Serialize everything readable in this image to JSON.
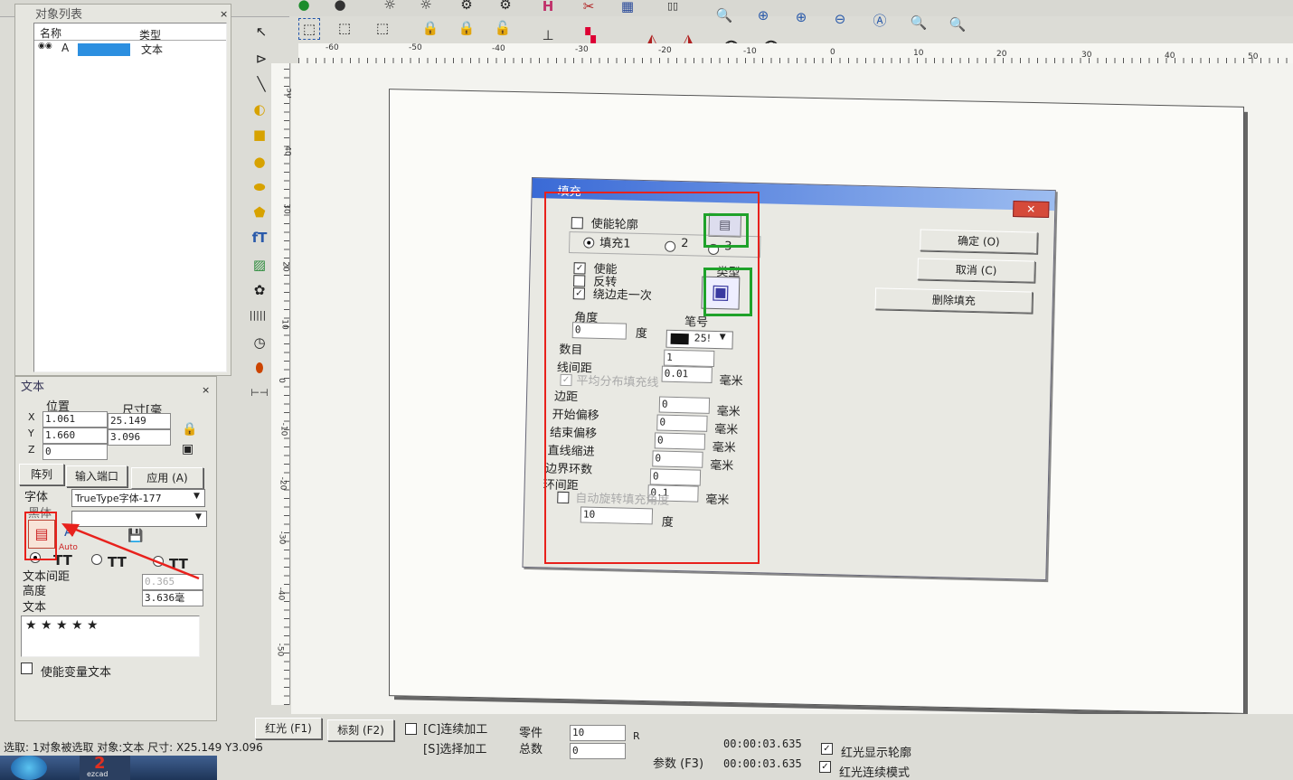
{
  "object_list": {
    "title": "对象列表",
    "col_name": "名称",
    "col_type": "类型",
    "row": {
      "name": "A",
      "type": "文本"
    }
  },
  "text_panel": {
    "title": "文本",
    "pos_label": "位置",
    "size_label": "尺寸[毫",
    "x_label": "X",
    "x_pos": "1.061",
    "x_size": "25.149",
    "y_label": "Y",
    "y_pos": "1.660",
    "y_size": "3.096",
    "z_label": "Z",
    "z_pos": "0",
    "array_btn": "阵列",
    "input_port_btn": "输入端口",
    "apply_btn": "应用 (A)",
    "font_label": "字体",
    "font_value": "TrueType字体-177",
    "font2_label": "黑体",
    "auto_label": "Auto",
    "spacing_label": "文本间距",
    "spacing_value": "0.365",
    "height_label": "高度",
    "height_value": "3.636毫",
    "text_label": "文本",
    "text_value": "★ ★ ★ ★ ★",
    "variable_text": "使能变量文本"
  },
  "fill_dialog": {
    "title": "填充",
    "enable_outline": "使能轮廓",
    "fill1": "填充1",
    "opt2": "2",
    "opt3": "3",
    "enable": "使能",
    "invert": "反转",
    "edge_once": "绕边走一次",
    "type_label": "类型",
    "angle_label": "角度",
    "angle_value": "0",
    "degree": "度",
    "pen_label": "笔号",
    "pen_value": "25!",
    "count_label": "数目",
    "count_value": "1",
    "line_spacing_label": "线间距",
    "line_spacing_value": "0.01",
    "mm": "毫米",
    "avg_fill": "平均分布填充线",
    "margin_label": "边距",
    "margin_value": "0",
    "start_offset_label": "开始偏移",
    "start_offset_value": "0",
    "end_offset_label": "结束偏移",
    "end_offset_value": "0",
    "line_shrink_label": "直线缩进",
    "line_shrink_value": "0",
    "border_rings_label": "边界环数",
    "border_rings_value": "0",
    "ring_spacing_label": "环间距",
    "ring_spacing_value": "0.1",
    "auto_rotate": "自动旋转填充角度",
    "rotate_value": "10",
    "ok": "确定 (O)",
    "cancel": "取消 (C)",
    "delete_fill": "删除填充"
  },
  "ruler_h": [
    "-60",
    "-50",
    "-40",
    "-30",
    "-20",
    "-10",
    "0",
    "10",
    "20",
    "30",
    "40",
    "50"
  ],
  "ruler_v": [
    "50",
    "40",
    "30",
    "20",
    "10",
    "0",
    "-10",
    "-20",
    "-30",
    "-40",
    "-50"
  ],
  "bottom": {
    "red_light": "红光 (F1)",
    "mark": "标刻 (F2)",
    "continuous": "[C]连续加工",
    "select_process": "[S]选择加工",
    "parts_label": "零件",
    "parts_value": "10",
    "total_label": "总数",
    "total_value": "0",
    "r_label": "R",
    "param": "参数 (F3)",
    "time1": "00:00:03.635",
    "time2": "00:00:03.635",
    "show_outline": "红光显示轮廓",
    "red_continuous": "红光连续模式",
    "status": "选取: 1对象被选取 对象:文本 尺寸: X25.149 Y3.096",
    "taskbar_badge": "2",
    "taskbar_small": "ezcad"
  },
  "colors": {
    "highlight_red": "#e8211c",
    "highlight_green": "#1fa22a",
    "selection_blue": "#2c7be5"
  }
}
